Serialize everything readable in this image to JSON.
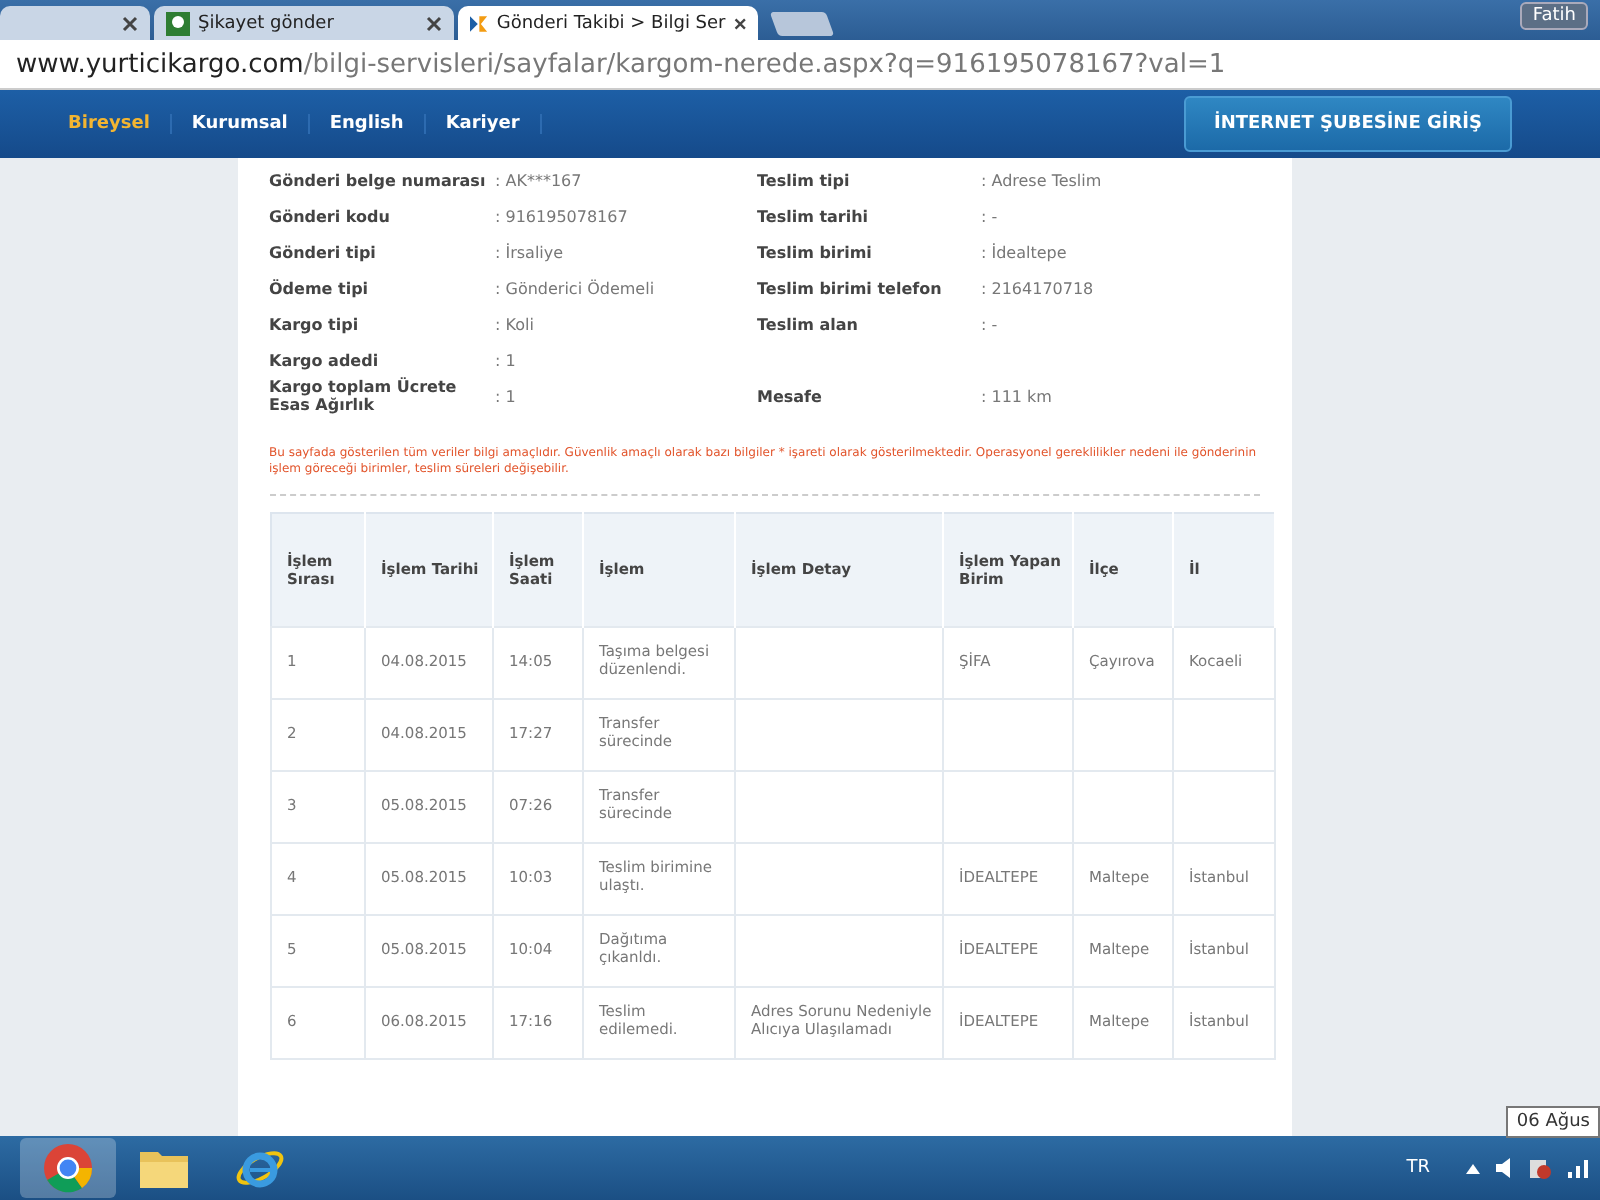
{
  "browser": {
    "tabs": [
      {
        "selected": false
      },
      {
        "title": "Şikayet gönder",
        "selected": false
      },
      {
        "title": "Gönderi Takibi > Bilgi Ser",
        "selected": true
      }
    ],
    "user": "Fatih",
    "url_host": "www.yurticikargo.com",
    "url_path": "/bilgi-servisleri/sayfalar/kargom-nerede.aspx?q=916195078167?val=1"
  },
  "nav": {
    "items": [
      {
        "label": "Bireysel",
        "selected": true
      },
      {
        "label": "Kurumsal",
        "selected": false
      },
      {
        "label": "English",
        "selected": false
      },
      {
        "label": "Kariyer",
        "selected": false
      }
    ],
    "login_button": "İNTERNET ŞUBESİNE GİRİŞ"
  },
  "details": [
    {
      "label": "Gönderi belge numarası",
      "value": ": AK***167",
      "label2": "Teslim tipi",
      "value2": ": Adrese Teslim"
    },
    {
      "label": "Gönderi kodu",
      "value": ": 916195078167",
      "label2": "Teslim tarihi",
      "value2": ": -"
    },
    {
      "label": "Gönderi tipi",
      "value": ": İrsaliye",
      "label2": "Teslim birimi",
      "value2": ": İdealtepe"
    },
    {
      "label": "Ödeme tipi",
      "value": ": Gönderici Ödemeli",
      "label2": "Teslim birimi telefon",
      "value2": ": 2164170718"
    },
    {
      "label": "Kargo tipi",
      "value": ": Koli",
      "label2": "Teslim alan",
      "value2": ": -"
    },
    {
      "label": "Kargo adedi",
      "value": ": 1"
    },
    {
      "label": "Kargo toplam Ücrete Esas Ağırlık",
      "value": ": 1",
      "label2": "Mesafe",
      "value2": ": 111 km"
    }
  ],
  "notice": "Bu sayfada gösterilen tüm veriler bilgi amaçlıdır. Güvenlik amaçlı olarak bazı bilgiler * işareti olarak gösterilmektedir. Operasyonel gereklilikler nedeni ile gönderinin işlem göreceği birimler, teslim süreleri değişebilir.",
  "table": {
    "columns": [
      "İşlem Sırası",
      "İşlem Tarihi",
      "İşlem Saati",
      "İşlem",
      "İşlem Detay",
      "İşlem Yapan Birim",
      "İlçe",
      "İl"
    ],
    "rows": [
      [
        "1",
        "04.08.2015",
        "14:05",
        "Taşıma belgesi düzenlendi.",
        "",
        "ŞİFA",
        "Çayırova",
        "Kocaeli"
      ],
      [
        "2",
        "04.08.2015",
        "17:27",
        "Transfer sürecinde",
        "",
        "",
        "",
        ""
      ],
      [
        "3",
        "05.08.2015",
        "07:26",
        "Transfer sürecinde",
        "",
        "",
        "",
        ""
      ],
      [
        "4",
        "05.08.2015",
        "10:03",
        "Teslim birimine ulaştı.",
        "",
        "İDEALTEPE",
        "Maltepe",
        "İstanbul"
      ],
      [
        "5",
        "05.08.2015",
        "10:04",
        "Dağıtıma çıkanldı.",
        "",
        "İDEALTEPE",
        "Maltepe",
        "İstanbul"
      ],
      [
        "6",
        "06.08.2015",
        "17:16",
        "Teslim edilemedi.",
        "Adres Sorunu Nedeniyle Alıcıya Ulaşılamadı",
        "İDEALTEPE",
        "Maltepe",
        "İstanbul"
      ]
    ]
  },
  "taskbar": {
    "language": "TR",
    "tooltip": "06 Ağus"
  }
}
